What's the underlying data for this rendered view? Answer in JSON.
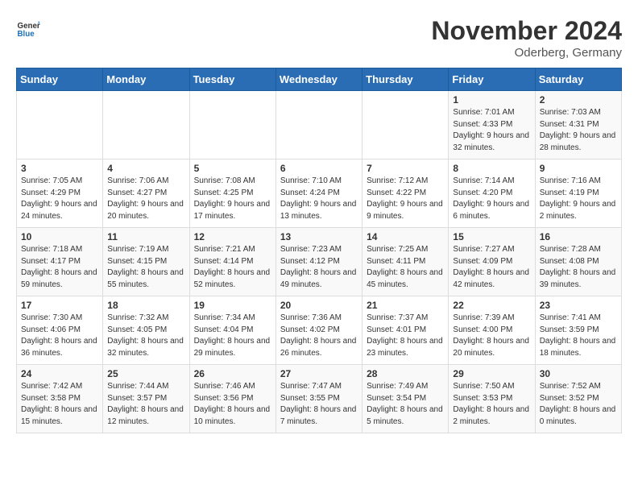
{
  "header": {
    "logo_general": "General",
    "logo_blue": "Blue",
    "title": "November 2024",
    "location": "Oderberg, Germany"
  },
  "weekdays": [
    "Sunday",
    "Monday",
    "Tuesday",
    "Wednesday",
    "Thursday",
    "Friday",
    "Saturday"
  ],
  "weeks": [
    [
      {
        "day": "",
        "info": ""
      },
      {
        "day": "",
        "info": ""
      },
      {
        "day": "",
        "info": ""
      },
      {
        "day": "",
        "info": ""
      },
      {
        "day": "",
        "info": ""
      },
      {
        "day": "1",
        "info": "Sunrise: 7:01 AM\nSunset: 4:33 PM\nDaylight: 9 hours and 32 minutes."
      },
      {
        "day": "2",
        "info": "Sunrise: 7:03 AM\nSunset: 4:31 PM\nDaylight: 9 hours and 28 minutes."
      }
    ],
    [
      {
        "day": "3",
        "info": "Sunrise: 7:05 AM\nSunset: 4:29 PM\nDaylight: 9 hours and 24 minutes."
      },
      {
        "day": "4",
        "info": "Sunrise: 7:06 AM\nSunset: 4:27 PM\nDaylight: 9 hours and 20 minutes."
      },
      {
        "day": "5",
        "info": "Sunrise: 7:08 AM\nSunset: 4:25 PM\nDaylight: 9 hours and 17 minutes."
      },
      {
        "day": "6",
        "info": "Sunrise: 7:10 AM\nSunset: 4:24 PM\nDaylight: 9 hours and 13 minutes."
      },
      {
        "day": "7",
        "info": "Sunrise: 7:12 AM\nSunset: 4:22 PM\nDaylight: 9 hours and 9 minutes."
      },
      {
        "day": "8",
        "info": "Sunrise: 7:14 AM\nSunset: 4:20 PM\nDaylight: 9 hours and 6 minutes."
      },
      {
        "day": "9",
        "info": "Sunrise: 7:16 AM\nSunset: 4:19 PM\nDaylight: 9 hours and 2 minutes."
      }
    ],
    [
      {
        "day": "10",
        "info": "Sunrise: 7:18 AM\nSunset: 4:17 PM\nDaylight: 8 hours and 59 minutes."
      },
      {
        "day": "11",
        "info": "Sunrise: 7:19 AM\nSunset: 4:15 PM\nDaylight: 8 hours and 55 minutes."
      },
      {
        "day": "12",
        "info": "Sunrise: 7:21 AM\nSunset: 4:14 PM\nDaylight: 8 hours and 52 minutes."
      },
      {
        "day": "13",
        "info": "Sunrise: 7:23 AM\nSunset: 4:12 PM\nDaylight: 8 hours and 49 minutes."
      },
      {
        "day": "14",
        "info": "Sunrise: 7:25 AM\nSunset: 4:11 PM\nDaylight: 8 hours and 45 minutes."
      },
      {
        "day": "15",
        "info": "Sunrise: 7:27 AM\nSunset: 4:09 PM\nDaylight: 8 hours and 42 minutes."
      },
      {
        "day": "16",
        "info": "Sunrise: 7:28 AM\nSunset: 4:08 PM\nDaylight: 8 hours and 39 minutes."
      }
    ],
    [
      {
        "day": "17",
        "info": "Sunrise: 7:30 AM\nSunset: 4:06 PM\nDaylight: 8 hours and 36 minutes."
      },
      {
        "day": "18",
        "info": "Sunrise: 7:32 AM\nSunset: 4:05 PM\nDaylight: 8 hours and 32 minutes."
      },
      {
        "day": "19",
        "info": "Sunrise: 7:34 AM\nSunset: 4:04 PM\nDaylight: 8 hours and 29 minutes."
      },
      {
        "day": "20",
        "info": "Sunrise: 7:36 AM\nSunset: 4:02 PM\nDaylight: 8 hours and 26 minutes."
      },
      {
        "day": "21",
        "info": "Sunrise: 7:37 AM\nSunset: 4:01 PM\nDaylight: 8 hours and 23 minutes."
      },
      {
        "day": "22",
        "info": "Sunrise: 7:39 AM\nSunset: 4:00 PM\nDaylight: 8 hours and 20 minutes."
      },
      {
        "day": "23",
        "info": "Sunrise: 7:41 AM\nSunset: 3:59 PM\nDaylight: 8 hours and 18 minutes."
      }
    ],
    [
      {
        "day": "24",
        "info": "Sunrise: 7:42 AM\nSunset: 3:58 PM\nDaylight: 8 hours and 15 minutes."
      },
      {
        "day": "25",
        "info": "Sunrise: 7:44 AM\nSunset: 3:57 PM\nDaylight: 8 hours and 12 minutes."
      },
      {
        "day": "26",
        "info": "Sunrise: 7:46 AM\nSunset: 3:56 PM\nDaylight: 8 hours and 10 minutes."
      },
      {
        "day": "27",
        "info": "Sunrise: 7:47 AM\nSunset: 3:55 PM\nDaylight: 8 hours and 7 minutes."
      },
      {
        "day": "28",
        "info": "Sunrise: 7:49 AM\nSunset: 3:54 PM\nDaylight: 8 hours and 5 minutes."
      },
      {
        "day": "29",
        "info": "Sunrise: 7:50 AM\nSunset: 3:53 PM\nDaylight: 8 hours and 2 minutes."
      },
      {
        "day": "30",
        "info": "Sunrise: 7:52 AM\nSunset: 3:52 PM\nDaylight: 8 hours and 0 minutes."
      }
    ]
  ]
}
